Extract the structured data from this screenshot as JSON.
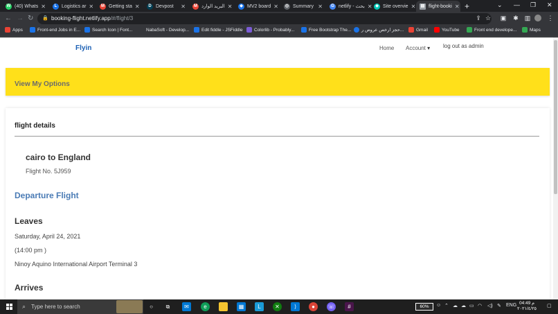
{
  "browser": {
    "tabs": [
      {
        "label": "(40) Whats",
        "color": "#25d366",
        "glyph": "W"
      },
      {
        "label": "Logistics ar",
        "color": "#1a73e8",
        "glyph": "L"
      },
      {
        "label": "Getting sta",
        "color": "#ea4335",
        "glyph": "M"
      },
      {
        "label": "Devpost",
        "color": "#003e54",
        "glyph": "D"
      },
      {
        "label": "البريد الوارد",
        "color": "#ea4335",
        "glyph": "M"
      },
      {
        "label": "MV2 board",
        "color": "#1a73e8",
        "glyph": "◆"
      },
      {
        "label": "Summary",
        "color": "#5f6368",
        "glyph": "◎"
      },
      {
        "label": "netlify - بحث",
        "color": "#4285f4",
        "glyph": "G"
      },
      {
        "label": "Site overvie",
        "color": "#00c7b7",
        "glyph": "◆"
      },
      {
        "label": "flight-booki",
        "color": "#9aa0a6",
        "glyph": "▤"
      }
    ],
    "new_tab": "+",
    "url_host": "booking-flight.netlify.app",
    "url_path": "/#/flight/3",
    "bookmarks": [
      {
        "label": "Apps",
        "color": "#ea4335"
      },
      {
        "label": "Front-end Jobs in E...",
        "color": "#1a73e8"
      },
      {
        "label": "Search Icon | Font...",
        "color": "#1a73e8"
      },
      {
        "label": "NabaSoft - Develop...",
        "color": "#35363a"
      },
      {
        "label": "Edit fiddle - JSFiddle",
        "color": "#1a73e8"
      },
      {
        "label": "Colorlib - Probably...",
        "color": "#7b5cd6"
      },
      {
        "label": "Free Bootstrap The...",
        "color": "#1a73e8"
      },
      {
        "label": "حجز ارخص عروض ر...",
        "color": "#1a73e8"
      },
      {
        "label": "Gmail",
        "color": "#ea4335"
      },
      {
        "label": "YouTube",
        "color": "#ff0000"
      },
      {
        "label": "Front end develope...",
        "color": "#34a853"
      },
      {
        "label": "Maps",
        "color": "#34a853"
      }
    ]
  },
  "site": {
    "brand": "Flyin",
    "nav": {
      "home": "Home",
      "account": "Account",
      "logout": "log out as admin"
    },
    "banner_title": "View My Options",
    "card_title": "flight details",
    "route": "cairo to England",
    "flight_no": "Flight No. 5J959",
    "departure_heading": "Departure Flight",
    "leaves_heading": "Leaves",
    "leaves_date": "Saturday, April 24, 2021",
    "leaves_time": "(14:00 pm )",
    "leaves_airport": "Ninoy Aquino International Airport Terminal 3",
    "arrives_heading": "Arrives"
  },
  "taskbar": {
    "search_placeholder": "Type here to search",
    "battery": "60%",
    "language": "ENG",
    "time": "04:49 م",
    "date": "٢٠٢١/٤/٢٥"
  }
}
